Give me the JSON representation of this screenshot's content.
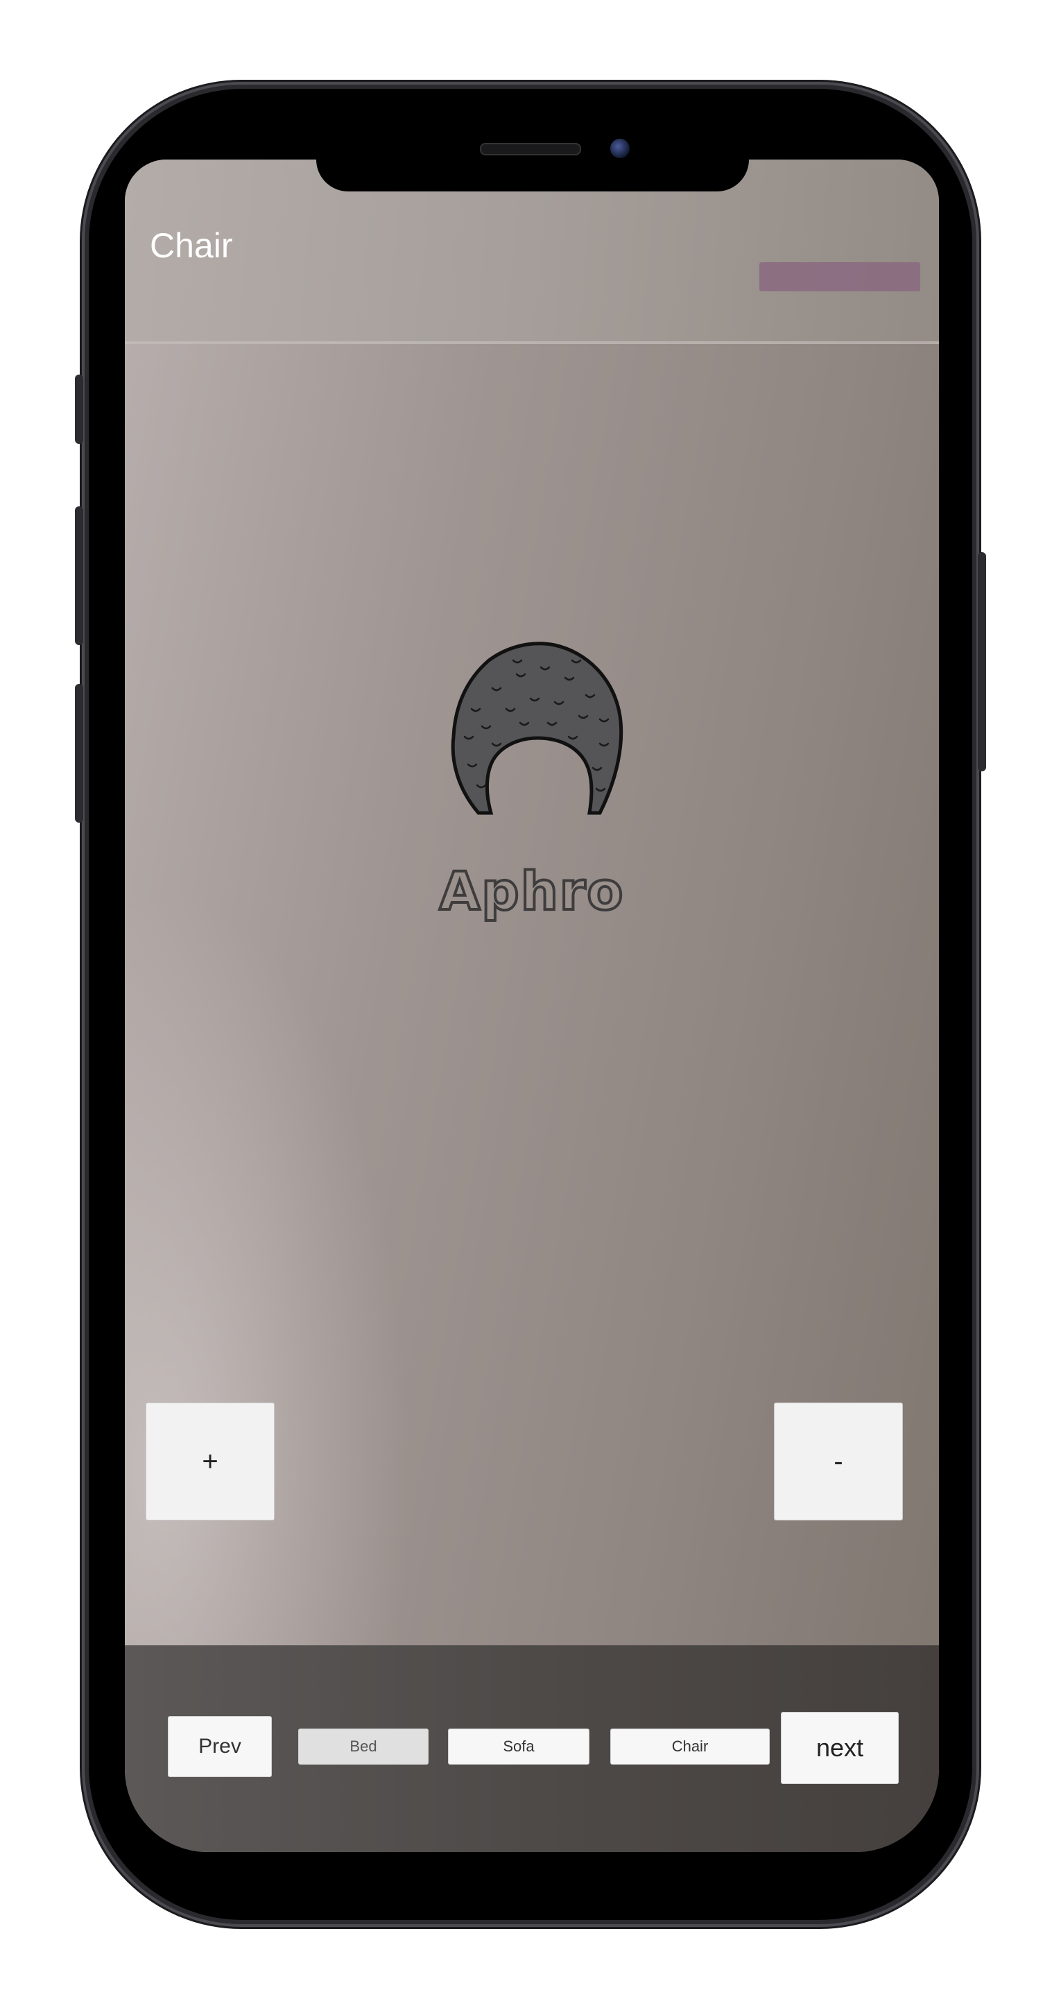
{
  "screen": {
    "title": "Chair",
    "model_name": "Aphro"
  },
  "controls": {
    "zoom_in_label": "+",
    "zoom_out_label": "-"
  },
  "bottom_bar": {
    "prev_label": "Prev",
    "next_label": "next",
    "categories": [
      "Bed",
      "Sofa",
      "Chair"
    ]
  },
  "colors": {
    "accent_bar": "#8a6a80",
    "button_bg": "#f2f2f2"
  }
}
